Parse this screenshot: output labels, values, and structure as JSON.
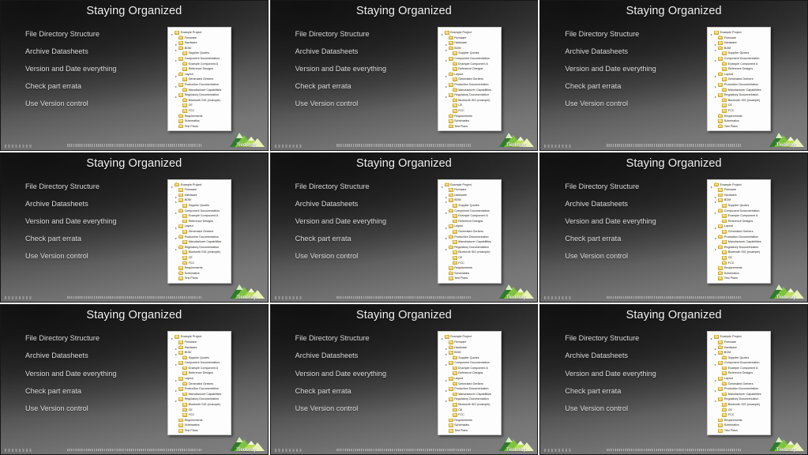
{
  "grid": {
    "rows": 3,
    "columns": 3,
    "panel_count": 9
  },
  "slide": {
    "title": "Staying Organized",
    "bullets": [
      "File Directory Structure",
      "Archive Datasheets",
      "Version and Date everything",
      "Check part errata",
      "Use Version control"
    ],
    "file_tree": [
      {
        "label": "Example Project",
        "level": 0,
        "expandable": true
      },
      {
        "label": "Firmware",
        "level": 1,
        "expandable": false
      },
      {
        "label": "Hardware",
        "level": 1,
        "expandable": true
      },
      {
        "label": "BOM",
        "level": 1,
        "expandable": true
      },
      {
        "label": "Supplier Quotes",
        "level": 2,
        "expandable": false
      },
      {
        "label": "Component Documentation",
        "level": 1,
        "expandable": true
      },
      {
        "label": "Example Component A",
        "level": 2,
        "expandable": false
      },
      {
        "label": "Reference Designs",
        "level": 2,
        "expandable": false
      },
      {
        "label": "Layout",
        "level": 1,
        "expandable": true
      },
      {
        "label": "Generated Gerbers",
        "level": 2,
        "expandable": false
      },
      {
        "label": "Production Documentation",
        "level": 1,
        "expandable": true
      },
      {
        "label": "Manufacturer Capabilities",
        "level": 2,
        "expandable": false
      },
      {
        "label": "Regulatory Documentation",
        "level": 1,
        "expandable": true
      },
      {
        "label": "Bluetooth SIG (example)",
        "level": 2,
        "expandable": false
      },
      {
        "label": "CE",
        "level": 2,
        "expandable": false
      },
      {
        "label": "FCC",
        "level": 2,
        "expandable": false
      },
      {
        "label": "Requirements",
        "level": 1,
        "expandable": false
      },
      {
        "label": "Schematics",
        "level": 1,
        "expandable": false
      },
      {
        "label": "Test Plans",
        "level": 1,
        "expandable": false
      }
    ],
    "logo": {
      "wordmark": "Tiederoy",
      "icon": "mountain-logo-icon"
    },
    "footer": {
      "left_text": "",
      "center_text": ""
    }
  },
  "colors": {
    "title_text": "#f2f2f2",
    "bullet_text": "#dcdcdc",
    "slide_dark": "#232323",
    "slide_light": "#808080",
    "tree_background": "#fdfdfd",
    "folder_yellow": "#e8c95a",
    "logo_green": "#5aa832"
  }
}
